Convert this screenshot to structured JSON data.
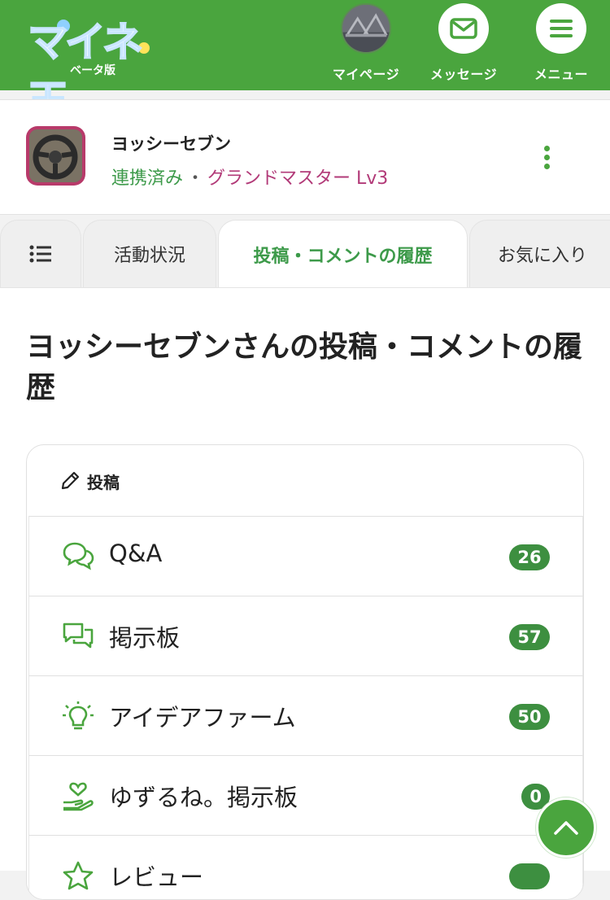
{
  "header": {
    "logo_text": "マイネ王",
    "logo_sub": "ベータ版",
    "nav": [
      {
        "label": "マイページ",
        "icon": "avatar"
      },
      {
        "label": "メッセージ",
        "icon": "envelope-icon"
      },
      {
        "label": "メニュー",
        "icon": "hamburger-icon"
      }
    ],
    "brand_color": "#4aa53e"
  },
  "profile": {
    "name": "ヨッシーセブン",
    "linked": "連携済み",
    "separator": "・",
    "rank": "グランドマスター Lv3"
  },
  "tabs": [
    {
      "label": "",
      "icon": "list-icon"
    },
    {
      "label": "活動状況"
    },
    {
      "label": "投稿・コメントの履歴",
      "active": true
    },
    {
      "label": "お気に入り"
    }
  ],
  "page_title": "ヨッシーセブンさんの投稿・コメントの履歴",
  "posts": {
    "heading": "投稿",
    "items": [
      {
        "label": "Q&A",
        "count": "26",
        "icon": "chat-bubbles-icon"
      },
      {
        "label": "掲示板",
        "count": "57",
        "icon": "board-chat-icon"
      },
      {
        "label": "アイデアファーム",
        "count": "50",
        "icon": "lightbulb-icon"
      },
      {
        "label": "ゆずるね。掲示板",
        "count": "0",
        "icon": "hand-heart-icon"
      },
      {
        "label": "レビュー",
        "count": "",
        "icon": "star-icon"
      }
    ]
  }
}
